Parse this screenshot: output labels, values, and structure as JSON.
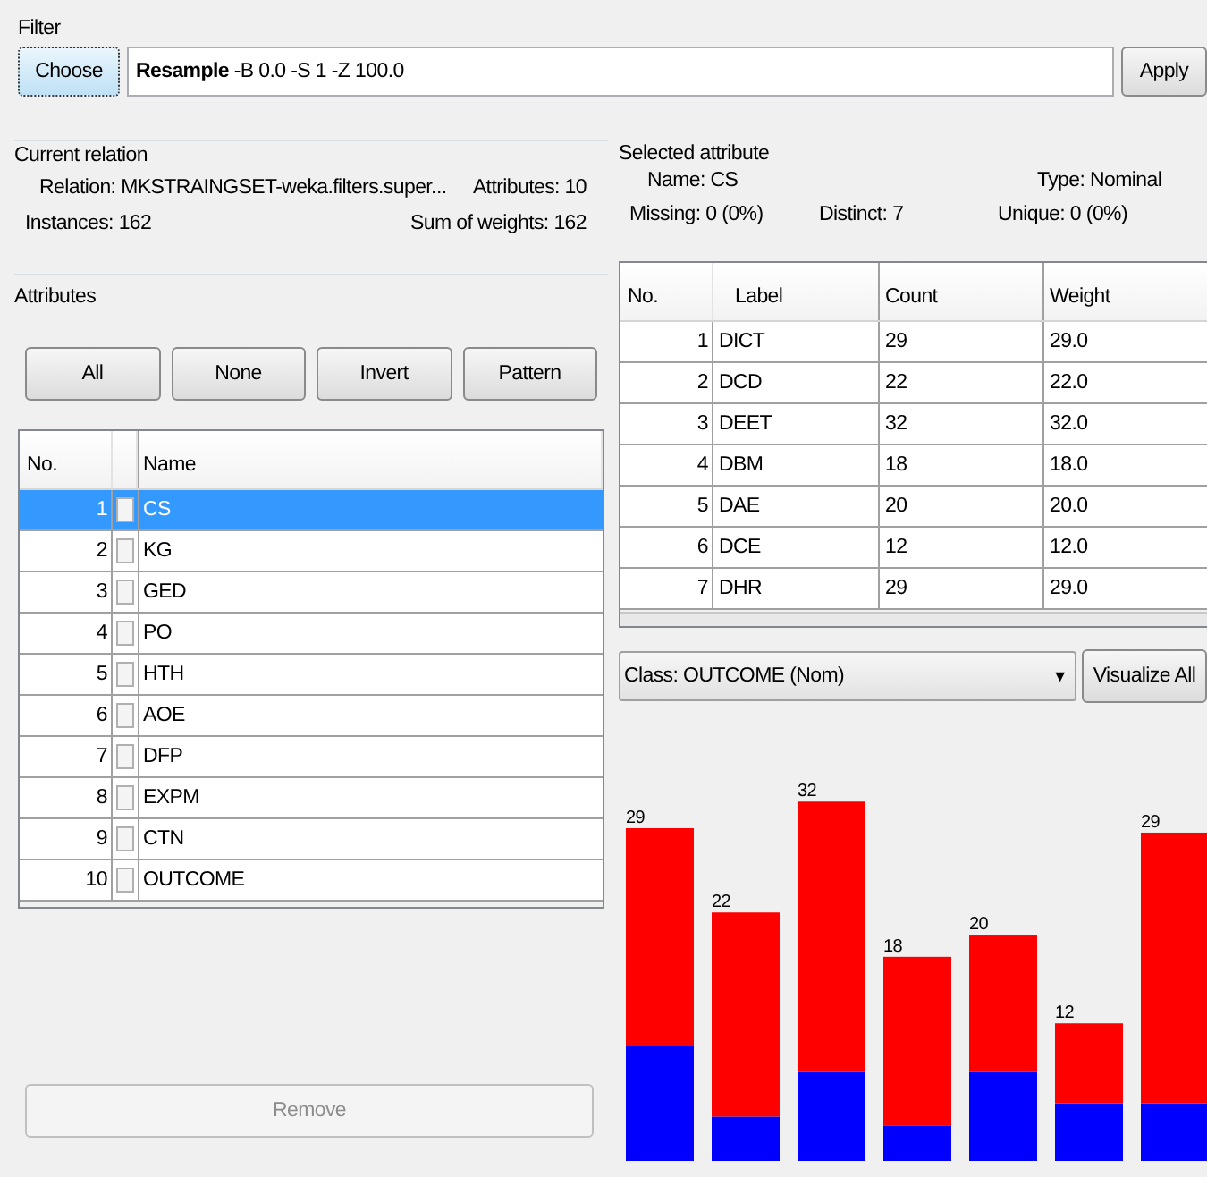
{
  "filter": {
    "title": "Filter",
    "choose_button": "Choose",
    "filter_name": "Resample",
    "filter_options": "-B 0.0 -S 1 -Z 100.0",
    "apply_button": "Apply"
  },
  "current_relation": {
    "title": "Current relation",
    "relation": "Relation: MKSTRAINGSET-weka.filters.super...",
    "attributes": "Attributes: 10",
    "instances": "Instances: 162",
    "sum_of_weights": "Sum of weights: 162"
  },
  "attributes": {
    "title": "Attributes",
    "buttons": [
      "All",
      "None",
      "Invert",
      "Pattern"
    ],
    "columns": [
      "No.",
      "Name"
    ],
    "rows": [
      {
        "no": "1",
        "name": "CS",
        "checked": false,
        "selected": true
      },
      {
        "no": "2",
        "name": "KG",
        "checked": false,
        "selected": false
      },
      {
        "no": "3",
        "name": "GED",
        "checked": false,
        "selected": false
      },
      {
        "no": "4",
        "name": "PO",
        "checked": false,
        "selected": false
      },
      {
        "no": "5",
        "name": "HTH",
        "checked": false,
        "selected": false
      },
      {
        "no": "6",
        "name": "AOE",
        "checked": false,
        "selected": false
      },
      {
        "no": "7",
        "name": "DFP",
        "checked": false,
        "selected": false
      },
      {
        "no": "8",
        "name": "EXPM",
        "checked": false,
        "selected": false
      },
      {
        "no": "9",
        "name": "CTN",
        "checked": false,
        "selected": false
      },
      {
        "no": "10",
        "name": "OUTCOME",
        "checked": false,
        "selected": false
      }
    ],
    "remove_button": {
      "label": "Remove",
      "disabled": true
    }
  },
  "selected_attribute": {
    "title": "Selected attribute",
    "name": "Name: CS",
    "type": "Type: Nominal",
    "missing": "Missing: 0 (0%)",
    "distinct": "Distinct: 7",
    "unique": "Unique: 0 (0%)",
    "columns": [
      "No.",
      "Label",
      "Count",
      "Weight"
    ],
    "rows": [
      {
        "no": "1",
        "label": "DICT",
        "count": "29",
        "weight": "29.0"
      },
      {
        "no": "2",
        "label": "DCD",
        "count": "22",
        "weight": "22.0"
      },
      {
        "no": "3",
        "label": "DEET",
        "count": "32",
        "weight": "32.0"
      },
      {
        "no": "4",
        "label": "DBM",
        "count": "18",
        "weight": "18.0"
      },
      {
        "no": "5",
        "label": "DAE",
        "count": "20",
        "weight": "20.0"
      },
      {
        "no": "6",
        "label": "DCE",
        "count": "12",
        "weight": "12.0"
      },
      {
        "no": "7",
        "label": "DHR",
        "count": "29",
        "weight": "29.0"
      }
    ]
  },
  "class_dropdown": "Class: OUTCOME (Nom)",
  "dropdown_arrow": "▼",
  "visualize_all_button": "Visualize All",
  "histogram": {
    "bar_labels": [
      "29",
      "22",
      "32",
      "18",
      "20",
      "12",
      "29"
    ]
  }
}
